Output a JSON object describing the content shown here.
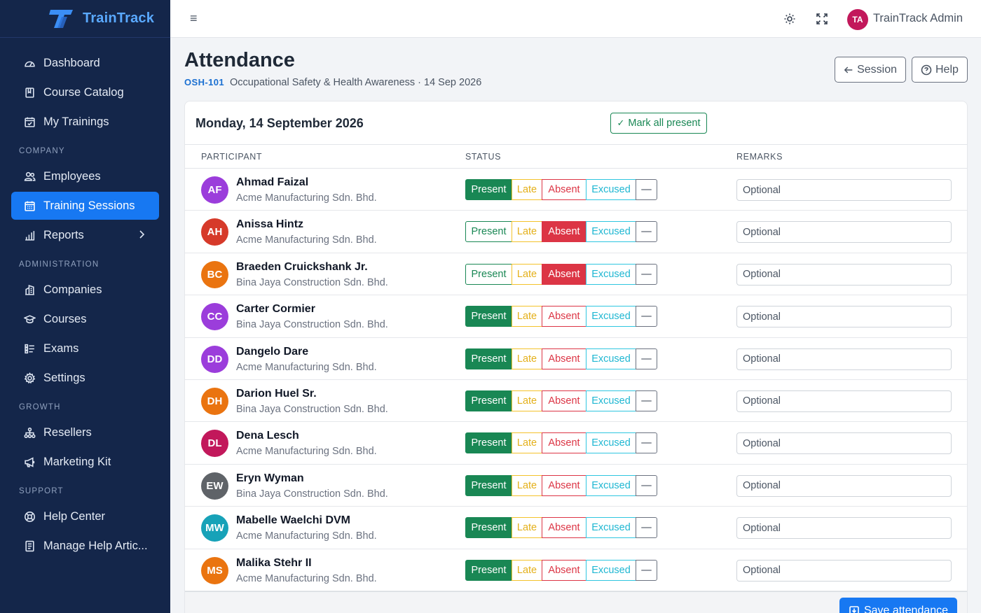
{
  "brand": {
    "name": "TrainTrack"
  },
  "sidebar": {
    "items_top": [
      {
        "label": "Dashboard",
        "icon": "dashboard-icon"
      },
      {
        "label": "Course Catalog",
        "icon": "book-icon"
      },
      {
        "label": "My Trainings",
        "icon": "calendar-check-icon"
      }
    ],
    "section_company": "COMPANY",
    "items_company": [
      {
        "label": "Employees",
        "icon": "users-icon"
      },
      {
        "label": "Training Sessions",
        "icon": "calendar-grid-icon",
        "active": true
      },
      {
        "label": "Reports",
        "icon": "bar-chart-icon",
        "has_children": true
      }
    ],
    "section_admin": "ADMINISTRATION",
    "items_admin": [
      {
        "label": "Companies",
        "icon": "building-icon"
      },
      {
        "label": "Courses",
        "icon": "graduation-cap-icon"
      },
      {
        "label": "Exams",
        "icon": "checklist-icon"
      },
      {
        "label": "Settings",
        "icon": "gear-icon"
      }
    ],
    "section_growth": "GROWTH",
    "items_growth": [
      {
        "label": "Resellers",
        "icon": "network-icon"
      },
      {
        "label": "Marketing Kit",
        "icon": "megaphone-icon"
      }
    ],
    "section_support": "SUPPORT",
    "items_support": [
      {
        "label": "Help Center",
        "icon": "lifebuoy-icon"
      },
      {
        "label": "Manage Help Artic...",
        "icon": "document-icon"
      }
    ]
  },
  "topbar": {
    "user_initials": "TA",
    "user_name": "TrainTrack Admin"
  },
  "page": {
    "title": "Attendance",
    "course_code": "OSH-101",
    "subtitle_rest": "Occupational Safety & Health Awareness · 14 Sep 2026",
    "session_btn": "Session",
    "help_btn": "Help"
  },
  "card": {
    "date_heading": "Monday, 14 September 2026",
    "mark_all": "Mark all present",
    "columns": {
      "participant": "PARTICIPANT",
      "status": "STATUS",
      "remarks": "REMARKS"
    },
    "status_labels": {
      "present": "Present",
      "late": "Late",
      "absent": "Absent",
      "excused": "Excused",
      "clear": "—"
    },
    "remark_placeholder": "Optional",
    "save_label": "Save attendance"
  },
  "participants": [
    {
      "initials": "AF",
      "name": "Ahmad Faizal",
      "company": "Acme Manufacturing Sdn. Bhd.",
      "status": "present",
      "color": "#9b3ddb"
    },
    {
      "initials": "AH",
      "name": "Anissa Hintz",
      "company": "Acme Manufacturing Sdn. Bhd.",
      "status": "absent",
      "color": "#d63a2a"
    },
    {
      "initials": "BC",
      "name": "Braeden Cruickshank Jr.",
      "company": "Bina Jaya Construction Sdn. Bhd.",
      "status": "absent",
      "color": "#ea7410"
    },
    {
      "initials": "CC",
      "name": "Carter Cormier",
      "company": "Bina Jaya Construction Sdn. Bhd.",
      "status": "present",
      "color": "#9b3ddb"
    },
    {
      "initials": "DD",
      "name": "Dangelo Dare",
      "company": "Acme Manufacturing Sdn. Bhd.",
      "status": "present",
      "color": "#9b3ddb"
    },
    {
      "initials": "DH",
      "name": "Darion Huel Sr.",
      "company": "Bina Jaya Construction Sdn. Bhd.",
      "status": "present",
      "color": "#ea7410"
    },
    {
      "initials": "DL",
      "name": "Dena Lesch",
      "company": "Acme Manufacturing Sdn. Bhd.",
      "status": "present",
      "color": "#c2185b"
    },
    {
      "initials": "EW",
      "name": "Eryn Wyman",
      "company": "Bina Jaya Construction Sdn. Bhd.",
      "status": "present",
      "color": "#5f6368"
    },
    {
      "initials": "MW",
      "name": "Mabelle Waelchi DVM",
      "company": "Acme Manufacturing Sdn. Bhd.",
      "status": "present",
      "color": "#17a2b8"
    },
    {
      "initials": "MS",
      "name": "Malika Stehr II",
      "company": "Acme Manufacturing Sdn. Bhd.",
      "status": "present",
      "color": "#ea7410"
    }
  ]
}
